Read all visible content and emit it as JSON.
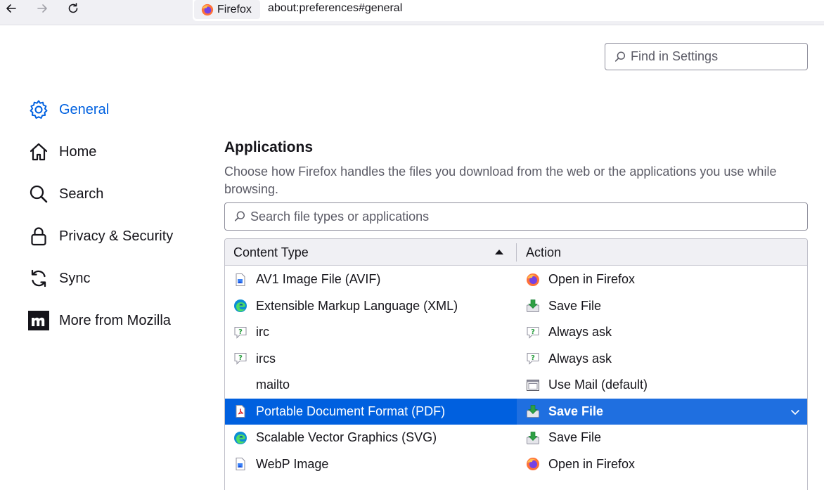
{
  "browser": {
    "identity_label": "Firefox",
    "url": "about:preferences#general"
  },
  "search": {
    "placeholder": "Find in Settings"
  },
  "sidebar": {
    "items": [
      {
        "label": "General",
        "icon": "gear-icon",
        "active": true
      },
      {
        "label": "Home",
        "icon": "home-icon"
      },
      {
        "label": "Search",
        "icon": "search-icon"
      },
      {
        "label": "Privacy & Security",
        "icon": "lock-icon"
      },
      {
        "label": "Sync",
        "icon": "sync-icon"
      },
      {
        "label": "More from Mozilla",
        "icon": "mozilla-icon"
      }
    ]
  },
  "applications": {
    "title": "Applications",
    "description": "Choose how Firefox handles the files you download from the web or the applications you use while browsing.",
    "filter_placeholder": "Search file types or applications",
    "columns": {
      "type": "Content Type",
      "action": "Action"
    },
    "rows": [
      {
        "type": "AV1 Image File (AVIF)",
        "type_icon": "image-file-icon",
        "action": "Open in Firefox",
        "action_icon": "firefox-icon"
      },
      {
        "type": "Extensible Markup Language (XML)",
        "type_icon": "edge-icon",
        "action": "Save File",
        "action_icon": "save-file-icon"
      },
      {
        "type": "irc",
        "type_icon": "ask-icon",
        "action": "Always ask",
        "action_icon": "ask-icon"
      },
      {
        "type": "ircs",
        "type_icon": "ask-icon",
        "action": "Always ask",
        "action_icon": "ask-icon"
      },
      {
        "type": "mailto",
        "type_icon": "",
        "action": "Use Mail (default)",
        "action_icon": "app-window-icon"
      },
      {
        "type": "Portable Document Format (PDF)",
        "type_icon": "pdf-icon",
        "action": "Save File",
        "action_icon": "save-file-icon",
        "selected": true
      },
      {
        "type": "Scalable Vector Graphics (SVG)",
        "type_icon": "edge-icon",
        "action": "Save File",
        "action_icon": "save-file-icon"
      },
      {
        "type": "WebP Image",
        "type_icon": "image-file-icon",
        "action": "Open in Firefox",
        "action_icon": "firefox-icon"
      }
    ]
  },
  "colors": {
    "accent": "#0061e0",
    "selected_row": "#0060df"
  }
}
